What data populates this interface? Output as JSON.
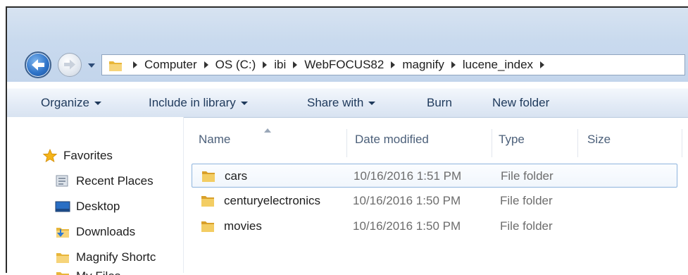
{
  "address": {
    "segments": [
      "Computer",
      "OS (C:)",
      "ibi",
      "WebFOCUS82",
      "magnify",
      "lucene_index"
    ]
  },
  "toolbar": {
    "organize": "Organize",
    "include_in_library": "Include in library",
    "share_with": "Share with",
    "burn": "Burn",
    "new_folder": "New folder"
  },
  "nav": {
    "favorites": "Favorites",
    "items": [
      "Recent Places",
      "Desktop",
      "Downloads",
      "Magnify Shortc",
      "My Files"
    ]
  },
  "columns": {
    "name": "Name",
    "date_modified": "Date modified",
    "type": "Type",
    "size": "Size"
  },
  "files": [
    {
      "name": "cars",
      "date": "10/16/2016 1:51 PM",
      "type": "File folder",
      "selected": true
    },
    {
      "name": "centuryelectronics",
      "date": "10/16/2016 1:50 PM",
      "type": "File folder",
      "selected": false
    },
    {
      "name": "movies",
      "date": "10/16/2016 1:50 PM",
      "type": "File folder",
      "selected": false
    }
  ],
  "colors": {
    "chrome": "#c9daee",
    "accent": "#1e395b",
    "folder": "#e8b63a"
  }
}
